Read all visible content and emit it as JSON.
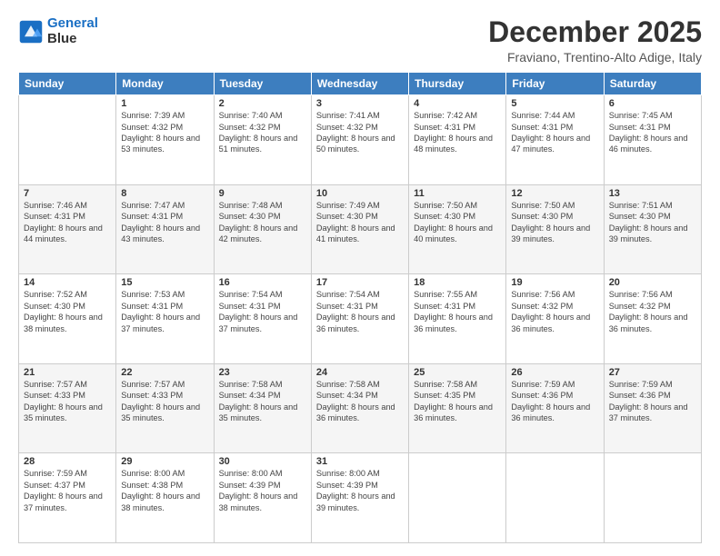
{
  "header": {
    "logo_line1": "General",
    "logo_line2": "Blue",
    "month_title": "December 2025",
    "location": "Fraviano, Trentino-Alto Adige, Italy"
  },
  "days_of_week": [
    "Sunday",
    "Monday",
    "Tuesday",
    "Wednesday",
    "Thursday",
    "Friday",
    "Saturday"
  ],
  "weeks": [
    [
      {
        "day": "",
        "sunrise": "",
        "sunset": "",
        "daylight": ""
      },
      {
        "day": "1",
        "sunrise": "Sunrise: 7:39 AM",
        "sunset": "Sunset: 4:32 PM",
        "daylight": "Daylight: 8 hours and 53 minutes."
      },
      {
        "day": "2",
        "sunrise": "Sunrise: 7:40 AM",
        "sunset": "Sunset: 4:32 PM",
        "daylight": "Daylight: 8 hours and 51 minutes."
      },
      {
        "day": "3",
        "sunrise": "Sunrise: 7:41 AM",
        "sunset": "Sunset: 4:32 PM",
        "daylight": "Daylight: 8 hours and 50 minutes."
      },
      {
        "day": "4",
        "sunrise": "Sunrise: 7:42 AM",
        "sunset": "Sunset: 4:31 PM",
        "daylight": "Daylight: 8 hours and 48 minutes."
      },
      {
        "day": "5",
        "sunrise": "Sunrise: 7:44 AM",
        "sunset": "Sunset: 4:31 PM",
        "daylight": "Daylight: 8 hours and 47 minutes."
      },
      {
        "day": "6",
        "sunrise": "Sunrise: 7:45 AM",
        "sunset": "Sunset: 4:31 PM",
        "daylight": "Daylight: 8 hours and 46 minutes."
      }
    ],
    [
      {
        "day": "7",
        "sunrise": "Sunrise: 7:46 AM",
        "sunset": "Sunset: 4:31 PM",
        "daylight": "Daylight: 8 hours and 44 minutes."
      },
      {
        "day": "8",
        "sunrise": "Sunrise: 7:47 AM",
        "sunset": "Sunset: 4:31 PM",
        "daylight": "Daylight: 8 hours and 43 minutes."
      },
      {
        "day": "9",
        "sunrise": "Sunrise: 7:48 AM",
        "sunset": "Sunset: 4:30 PM",
        "daylight": "Daylight: 8 hours and 42 minutes."
      },
      {
        "day": "10",
        "sunrise": "Sunrise: 7:49 AM",
        "sunset": "Sunset: 4:30 PM",
        "daylight": "Daylight: 8 hours and 41 minutes."
      },
      {
        "day": "11",
        "sunrise": "Sunrise: 7:50 AM",
        "sunset": "Sunset: 4:30 PM",
        "daylight": "Daylight: 8 hours and 40 minutes."
      },
      {
        "day": "12",
        "sunrise": "Sunrise: 7:50 AM",
        "sunset": "Sunset: 4:30 PM",
        "daylight": "Daylight: 8 hours and 39 minutes."
      },
      {
        "day": "13",
        "sunrise": "Sunrise: 7:51 AM",
        "sunset": "Sunset: 4:30 PM",
        "daylight": "Daylight: 8 hours and 39 minutes."
      }
    ],
    [
      {
        "day": "14",
        "sunrise": "Sunrise: 7:52 AM",
        "sunset": "Sunset: 4:30 PM",
        "daylight": "Daylight: 8 hours and 38 minutes."
      },
      {
        "day": "15",
        "sunrise": "Sunrise: 7:53 AM",
        "sunset": "Sunset: 4:31 PM",
        "daylight": "Daylight: 8 hours and 37 minutes."
      },
      {
        "day": "16",
        "sunrise": "Sunrise: 7:54 AM",
        "sunset": "Sunset: 4:31 PM",
        "daylight": "Daylight: 8 hours and 37 minutes."
      },
      {
        "day": "17",
        "sunrise": "Sunrise: 7:54 AM",
        "sunset": "Sunset: 4:31 PM",
        "daylight": "Daylight: 8 hours and 36 minutes."
      },
      {
        "day": "18",
        "sunrise": "Sunrise: 7:55 AM",
        "sunset": "Sunset: 4:31 PM",
        "daylight": "Daylight: 8 hours and 36 minutes."
      },
      {
        "day": "19",
        "sunrise": "Sunrise: 7:56 AM",
        "sunset": "Sunset: 4:32 PM",
        "daylight": "Daylight: 8 hours and 36 minutes."
      },
      {
        "day": "20",
        "sunrise": "Sunrise: 7:56 AM",
        "sunset": "Sunset: 4:32 PM",
        "daylight": "Daylight: 8 hours and 36 minutes."
      }
    ],
    [
      {
        "day": "21",
        "sunrise": "Sunrise: 7:57 AM",
        "sunset": "Sunset: 4:33 PM",
        "daylight": "Daylight: 8 hours and 35 minutes."
      },
      {
        "day": "22",
        "sunrise": "Sunrise: 7:57 AM",
        "sunset": "Sunset: 4:33 PM",
        "daylight": "Daylight: 8 hours and 35 minutes."
      },
      {
        "day": "23",
        "sunrise": "Sunrise: 7:58 AM",
        "sunset": "Sunset: 4:34 PM",
        "daylight": "Daylight: 8 hours and 35 minutes."
      },
      {
        "day": "24",
        "sunrise": "Sunrise: 7:58 AM",
        "sunset": "Sunset: 4:34 PM",
        "daylight": "Daylight: 8 hours and 36 minutes."
      },
      {
        "day": "25",
        "sunrise": "Sunrise: 7:58 AM",
        "sunset": "Sunset: 4:35 PM",
        "daylight": "Daylight: 8 hours and 36 minutes."
      },
      {
        "day": "26",
        "sunrise": "Sunrise: 7:59 AM",
        "sunset": "Sunset: 4:36 PM",
        "daylight": "Daylight: 8 hours and 36 minutes."
      },
      {
        "day": "27",
        "sunrise": "Sunrise: 7:59 AM",
        "sunset": "Sunset: 4:36 PM",
        "daylight": "Daylight: 8 hours and 37 minutes."
      }
    ],
    [
      {
        "day": "28",
        "sunrise": "Sunrise: 7:59 AM",
        "sunset": "Sunset: 4:37 PM",
        "daylight": "Daylight: 8 hours and 37 minutes."
      },
      {
        "day": "29",
        "sunrise": "Sunrise: 8:00 AM",
        "sunset": "Sunset: 4:38 PM",
        "daylight": "Daylight: 8 hours and 38 minutes."
      },
      {
        "day": "30",
        "sunrise": "Sunrise: 8:00 AM",
        "sunset": "Sunset: 4:39 PM",
        "daylight": "Daylight: 8 hours and 38 minutes."
      },
      {
        "day": "31",
        "sunrise": "Sunrise: 8:00 AM",
        "sunset": "Sunset: 4:39 PM",
        "daylight": "Daylight: 8 hours and 39 minutes."
      },
      {
        "day": "",
        "sunrise": "",
        "sunset": "",
        "daylight": ""
      },
      {
        "day": "",
        "sunrise": "",
        "sunset": "",
        "daylight": ""
      },
      {
        "day": "",
        "sunrise": "",
        "sunset": "",
        "daylight": ""
      }
    ]
  ]
}
